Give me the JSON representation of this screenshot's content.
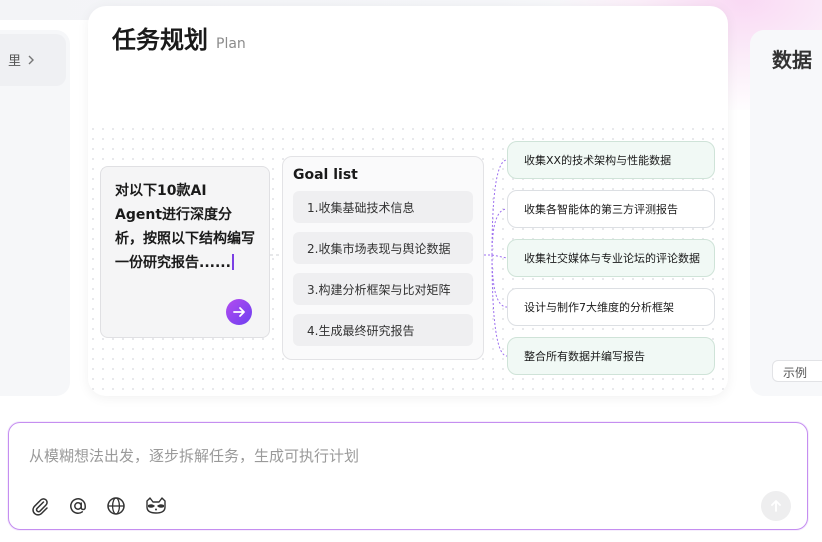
{
  "left_card": {
    "label": "里",
    "chevron": "chevron-right-icon"
  },
  "right_card": {
    "title": "数据",
    "tag": "示例"
  },
  "plan_card": {
    "title": "任务规划",
    "subtitle": "Plan",
    "prompt": "对以下10款AI Agent进行深度分析，按照以下结构编写一份研究报告......",
    "submit_icon": "arrow-right-icon",
    "goal_list": {
      "title": "Goal list",
      "items": [
        "1.收集基础技术信息",
        "2.收集市场表现与舆论数据",
        "3.构建分析框架与比对矩阵",
        "4.生成最终研究报告"
      ]
    },
    "tasks": [
      "收集XX的技术架构与性能数据",
      "收集各智能体的第三方评测报告",
      "收集社交媒体与专业论坛的评论数据",
      "设计与制作7大维度的分析框架",
      "整合所有数据并编写报告"
    ]
  },
  "composer": {
    "placeholder": "从模糊想法出发，逐步拆解任务，生成可执行计划",
    "value": "",
    "tools": [
      "paperclip-icon",
      "at-sign-icon",
      "globe-icon",
      "raccoon-agent-icon"
    ],
    "send_icon": "arrow-up-icon"
  },
  "colors": {
    "accent": "#8a3ff0",
    "border_focus": "#c58ef0",
    "task_highlight": "#f1f9f5"
  }
}
